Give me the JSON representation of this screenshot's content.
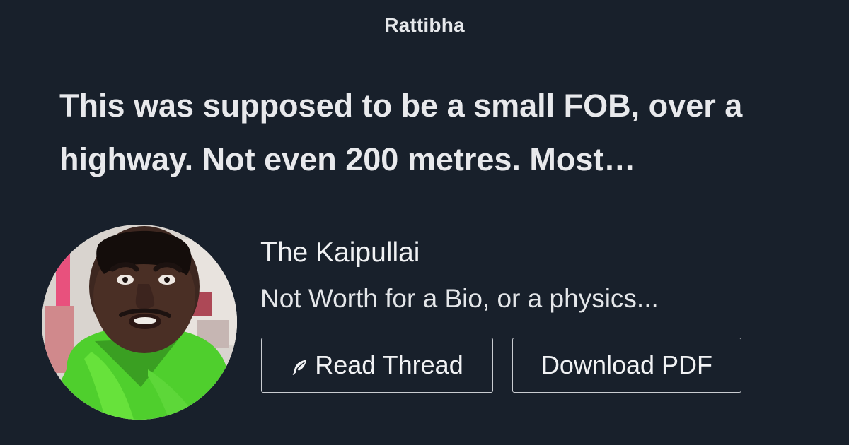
{
  "brand": {
    "name": "Rattibha"
  },
  "thread": {
    "title": "This was supposed to be a small FOB, over a highway. Not even 200 metres. Most…"
  },
  "author": {
    "name": "The Kaipullai",
    "bio": "Not Worth for a Bio, or a physics..."
  },
  "actions": {
    "read_label": "Read Thread",
    "download_label": "Download PDF"
  },
  "icons": {
    "read_icon": "feather-icon"
  },
  "colors": {
    "background": "#18202b",
    "text": "#e8eaed",
    "button_border": "#c9ccd1"
  }
}
